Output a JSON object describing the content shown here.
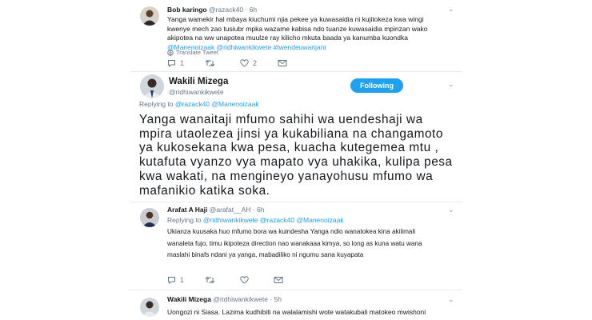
{
  "tweet1": {
    "name": "Bob karingo",
    "handle": "@razack40",
    "time": "· 6h",
    "text": "Yanga wamekir hal mbaya kiuchumi njia pekee ya kuwasaidia ni kujitokeza kwa wingi kwenye mech zao tusiubr mpka wazame kabisa ndo tuanze kuwasaidia mpinzan wako akipotea na ww unapotea muulze ray kilicho mkuta baada ya kanumba kuondka",
    "mentions": "@Manenoizaak @ridhiwankikwete #twendeuwanjani",
    "translate": "Translate Tweet",
    "replies": "1",
    "retweets": "",
    "likes": "2",
    "dm": ""
  },
  "main_tweet": {
    "name": "Wakili Mizega",
    "handle": "@ridhiwankikwete",
    "follow_label": "Following",
    "replying_prefix": "Replying to",
    "replying_to": "@razack40 @Manenoizaak",
    "text": "Yanga wanaitaji mfumo sahihi wa uendeshaji wa mpira utaolezea jinsi ya kukabiliana na changamoto ya kukosekana kwa pesa, kuacha kutegemea mtu , kutafuta vyanzo vya mapato vya uhakika, kulipa pesa kwa wakati, na mengineyo yanayohusu mfumo wa mafanikio katika soka."
  },
  "tweet3": {
    "name": "Arafat A Haji",
    "handle": "@arafat__AH",
    "time": "· 6h",
    "replying_prefix": "Replying to",
    "replying_to": "@ridhiwankikwete @razack40 @Manenoizaak",
    "text": "Ukianza kuusaka huo mfumo bora wa kuindesha Yanga ndio wanatokea kina akilimali wanaleta fujo, timu ikipoteza direction nao wanakaaa kimya, so long as kuna watu wana maslahi binafs ndani ya yanga, mabadiliko ni ngumu sana kuyapata",
    "replies": "1",
    "retweets": "",
    "likes": "",
    "dm": ""
  },
  "tweet4": {
    "name": "Wakili Mizega",
    "handle": "@ridhiwankikwete",
    "time": "· 5h",
    "text": "Uongozi ni Siasa. Lazima kudhibiti na walalamishi wote watakubali matokeo mwishoni"
  },
  "colors": {
    "accent": "#1da1f2",
    "muted": "#657786",
    "border": "#e6ecf0"
  },
  "icons": [
    "reply-icon",
    "retweet-icon",
    "like-icon",
    "dm-icon",
    "translate-globe-icon",
    "chevron-down-icon"
  ]
}
